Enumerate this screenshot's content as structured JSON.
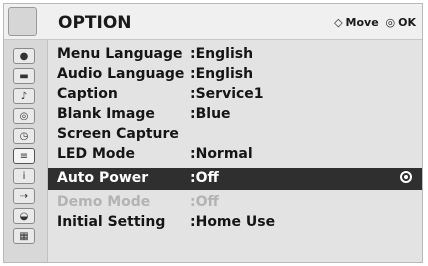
{
  "header": {
    "title": "OPTION",
    "move_label": "Move",
    "ok_label": "OK",
    "move_glyph": "◇",
    "ok_glyph": "◎"
  },
  "sidebar": {
    "icons": [
      {
        "name": "picture-icon",
        "glyph": "●"
      },
      {
        "name": "monitor-icon",
        "glyph": "▬"
      },
      {
        "name": "audio-icon",
        "glyph": "♪"
      },
      {
        "name": "disc-icon",
        "glyph": "◎"
      },
      {
        "name": "clock-icon",
        "glyph": "◷"
      },
      {
        "name": "option-icon",
        "glyph": "≡",
        "active": true
      },
      {
        "name": "info-icon",
        "glyph": "i"
      },
      {
        "name": "input-icon",
        "glyph": "⇢"
      },
      {
        "name": "usb-icon",
        "glyph": "◒"
      },
      {
        "name": "movie-icon",
        "glyph": "▦"
      }
    ]
  },
  "menu": {
    "rows": [
      {
        "label": "Menu Language",
        "value": ":English"
      },
      {
        "label": "Audio Language",
        "value": ":English"
      },
      {
        "label": "Caption",
        "value": ":Service1"
      },
      {
        "label": "Blank Image",
        "value": ":Blue"
      },
      {
        "label": "Screen Capture",
        "value": ""
      },
      {
        "label": "LED Mode",
        "value": ":Normal"
      },
      {
        "label": "Auto Power",
        "value": ":Off",
        "selected": true
      },
      {
        "label": "Demo Mode",
        "value": ":Off",
        "disabled": true
      },
      {
        "label": "Initial Setting",
        "value": ":Home Use"
      }
    ]
  }
}
